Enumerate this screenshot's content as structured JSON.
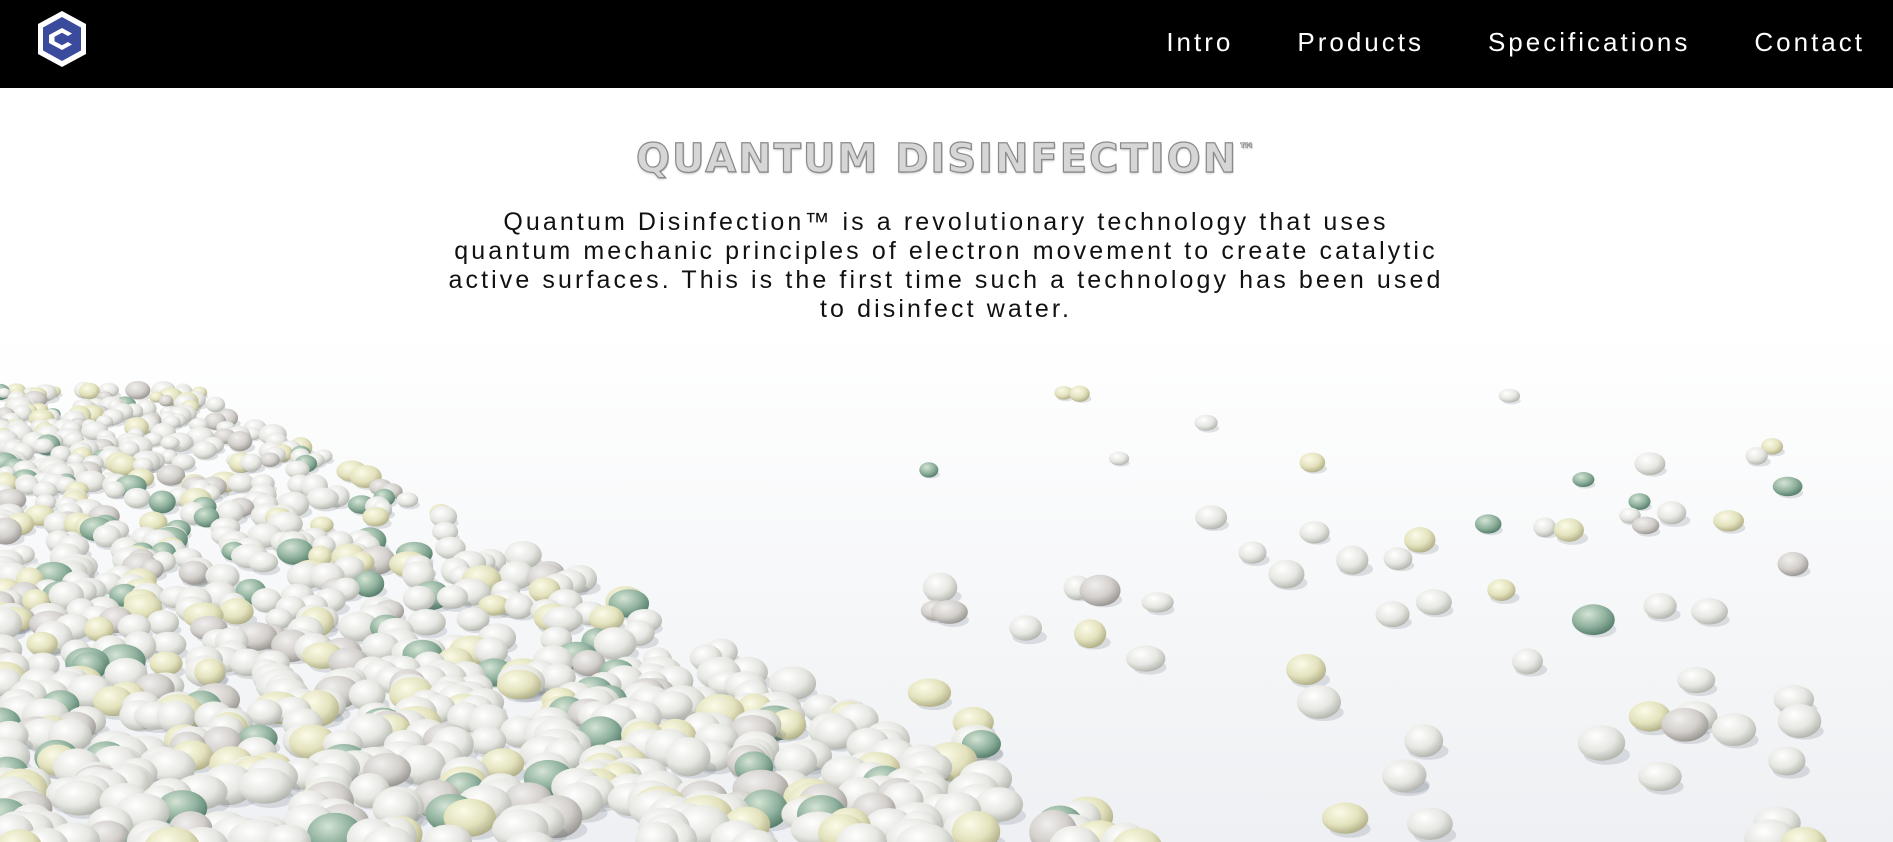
{
  "header": {
    "logo_icon": "hexagon-c-logo-icon",
    "colors": {
      "background": "#000000",
      "logo": "#3a4a9c",
      "text": "#ffffff"
    },
    "nav": [
      {
        "label": "Intro"
      },
      {
        "label": "Products"
      },
      {
        "label": "Specifications"
      },
      {
        "label": "Contact"
      }
    ]
  },
  "hero": {
    "title": "QUANTUM DISINFECTION",
    "title_mark": "™",
    "description": "Quantum Disinfection™ is a revolutionary technology that uses quantum mechanic principles of electron movement to create catalytic active surfaces. This is the first time such a technology has been used to disinfect water.",
    "image_subject": "white-ceramic-pebbles-image"
  }
}
